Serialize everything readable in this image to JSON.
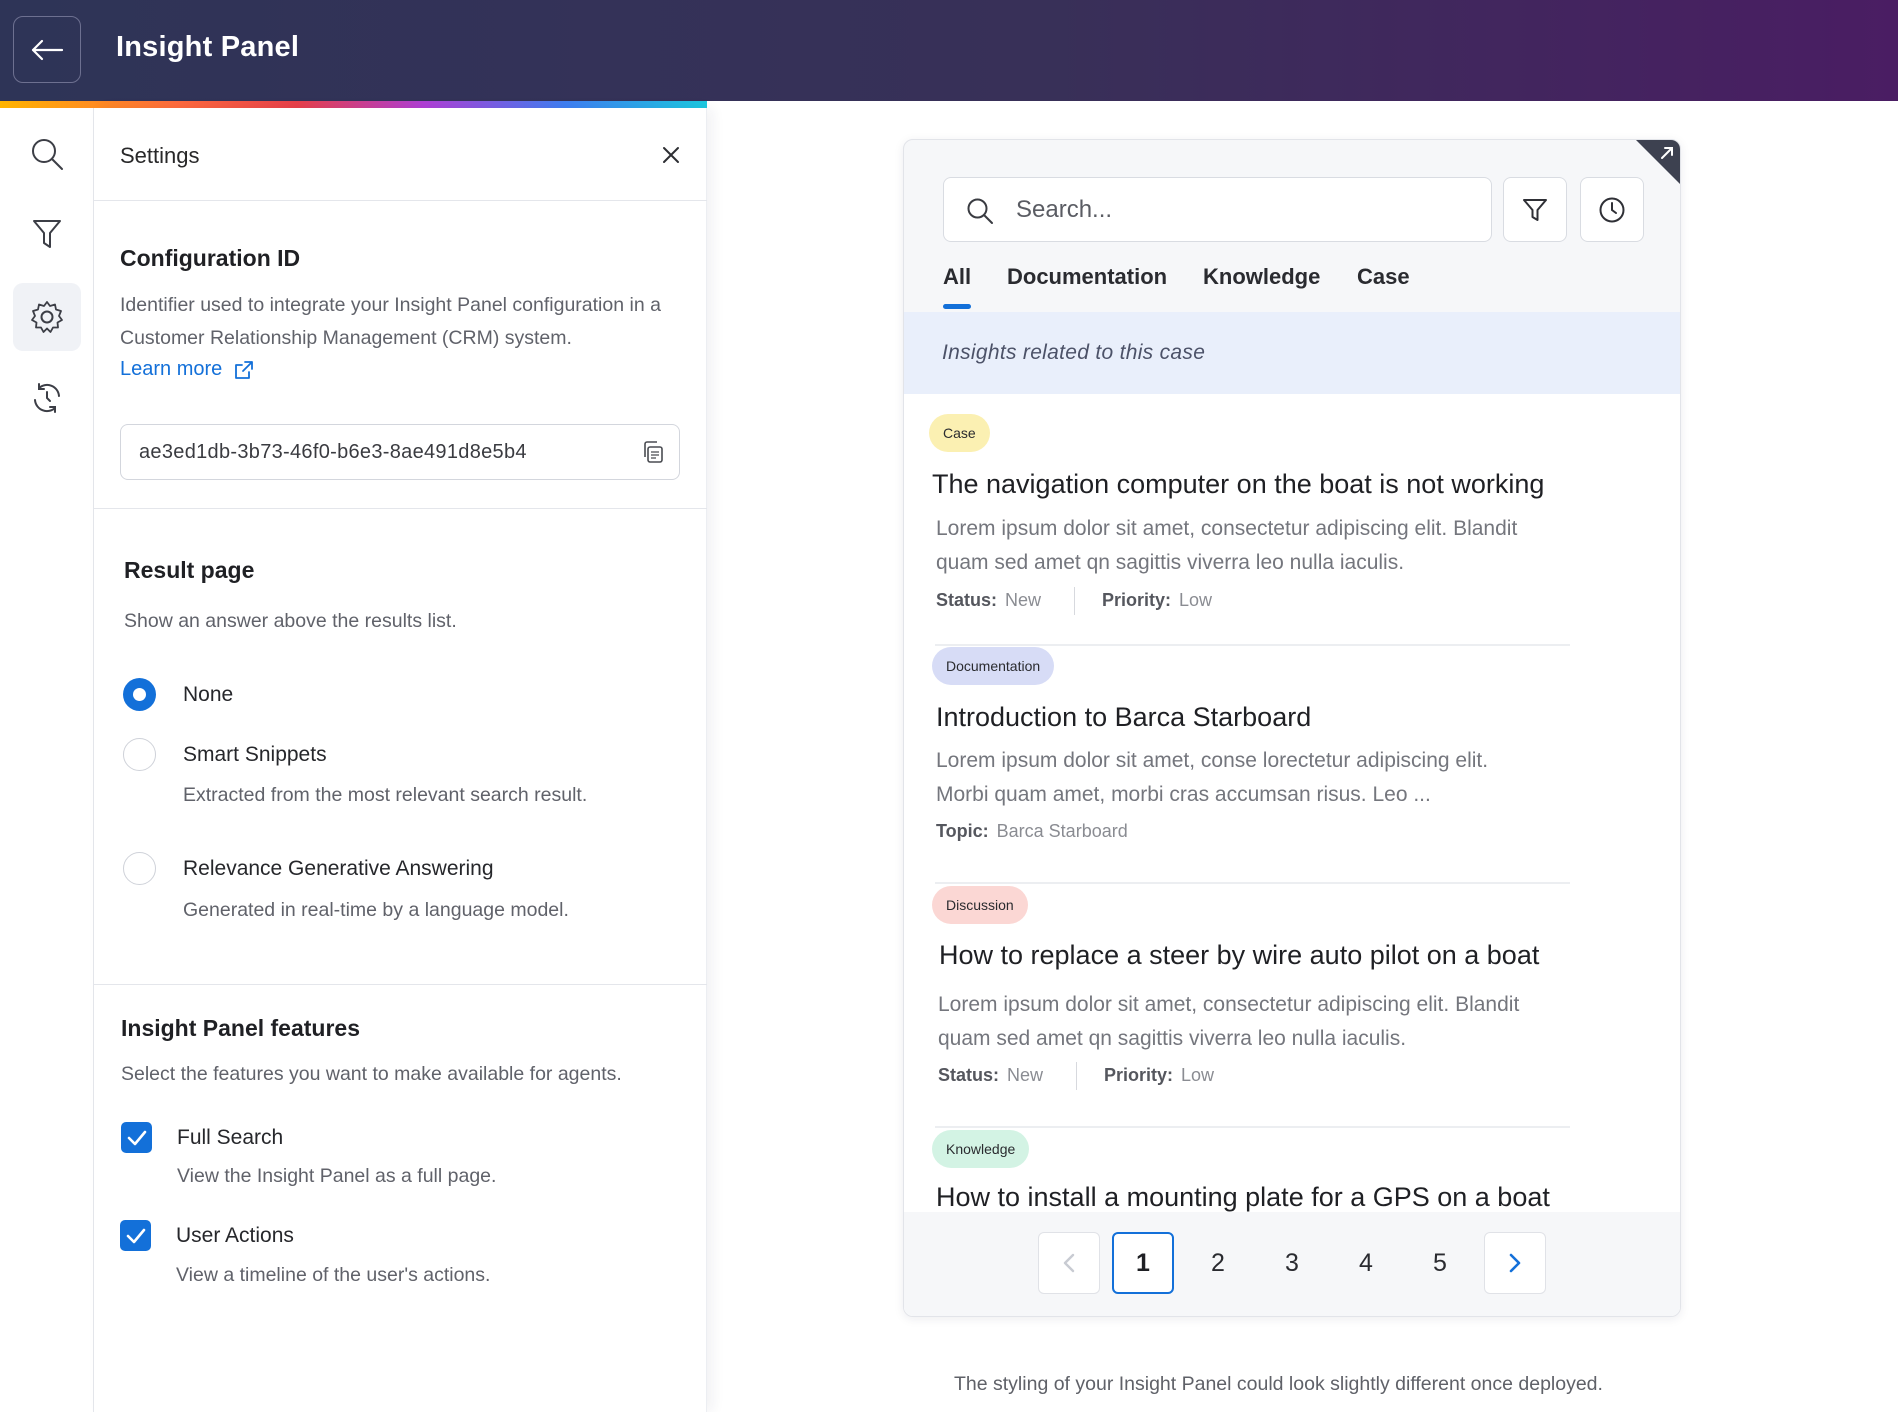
{
  "header": {
    "title": "Insight Panel"
  },
  "settings": {
    "title": "Settings",
    "config": {
      "title": "Configuration ID",
      "description_line1": "Identifier used to integrate your Insight Panel configuration in a",
      "description_line2": "Customer Relationship Management (CRM) system.",
      "learn_more": "Learn more",
      "id_value": "ae3ed1db-3b73-46f0-b6e3-8ae491d8e5b4"
    },
    "result_page": {
      "title": "Result page",
      "description": "Show an answer above the results list.",
      "options": [
        {
          "label": "None",
          "description": "",
          "selected": true
        },
        {
          "label": "Smart Snippets",
          "description": "Extracted from the most relevant search result.",
          "selected": false
        },
        {
          "label": "Relevance Generative Answering",
          "description": "Generated in real-time by a language model.",
          "selected": false
        }
      ]
    },
    "features": {
      "title": "Insight Panel features",
      "description": "Select the features you want to make available for agents.",
      "items": [
        {
          "label": "Full Search",
          "description": "View the Insight Panel as a full page.",
          "checked": true
        },
        {
          "label": "User Actions",
          "description": "View a timeline of the user's actions.",
          "checked": true
        }
      ]
    }
  },
  "preview": {
    "search_placeholder": "Search...",
    "tabs": [
      "All",
      "Documentation",
      "Knowledge",
      "Case"
    ],
    "active_tab": "All",
    "context": "Insights related to this case",
    "results": [
      {
        "badge": "Case",
        "badge_color": "#fbf0b2",
        "title": "The navigation computer on the boat is not working",
        "excerpt_line1": "Lorem ipsum dolor sit amet, consectetur adipiscing elit. Blandit",
        "excerpt_line2": "quam sed amet qn sagittis viverra leo nulla iaculis.",
        "meta": [
          {
            "key": "Status:",
            "value": "New"
          },
          {
            "key": "Priority:",
            "value": "Low"
          }
        ]
      },
      {
        "badge": "Documentation",
        "badge_color": "#d7dcf6",
        "title": "Introduction to Barca Starboard",
        "excerpt_line1": "Lorem ipsum dolor sit amet, conse  lorectetur adipiscing elit.",
        "excerpt_line2": "Morbi quam amet, morbi cras accumsan risus. Leo ...",
        "meta": [
          {
            "key": "Topic:",
            "value": "Barca Starboard"
          }
        ]
      },
      {
        "badge": "Discussion",
        "badge_color": "#fbd7d4",
        "title": "How to replace a steer by wire auto pilot on a boat",
        "excerpt_line1": "Lorem ipsum dolor sit amet, consectetur adipiscing elit. Blandit",
        "excerpt_line2": "quam sed amet qn sagittis viverra leo nulla iaculis.",
        "meta": [
          {
            "key": "Status:",
            "value": "New"
          },
          {
            "key": "Priority:",
            "value": "Low"
          }
        ]
      },
      {
        "badge": "Knowledge",
        "badge_color": "#d3f3e4",
        "title": "How to install a mounting plate for a GPS on a boat"
      }
    ],
    "pagination": {
      "pages": [
        "1",
        "2",
        "3",
        "4",
        "5"
      ],
      "current": "1"
    }
  },
  "footnote": "The styling of your Insight Panel could look slightly different once deployed.",
  "colors": {
    "accent": "#1370d9",
    "header_start": "#2e3457",
    "header_end": "#4a1d63"
  }
}
